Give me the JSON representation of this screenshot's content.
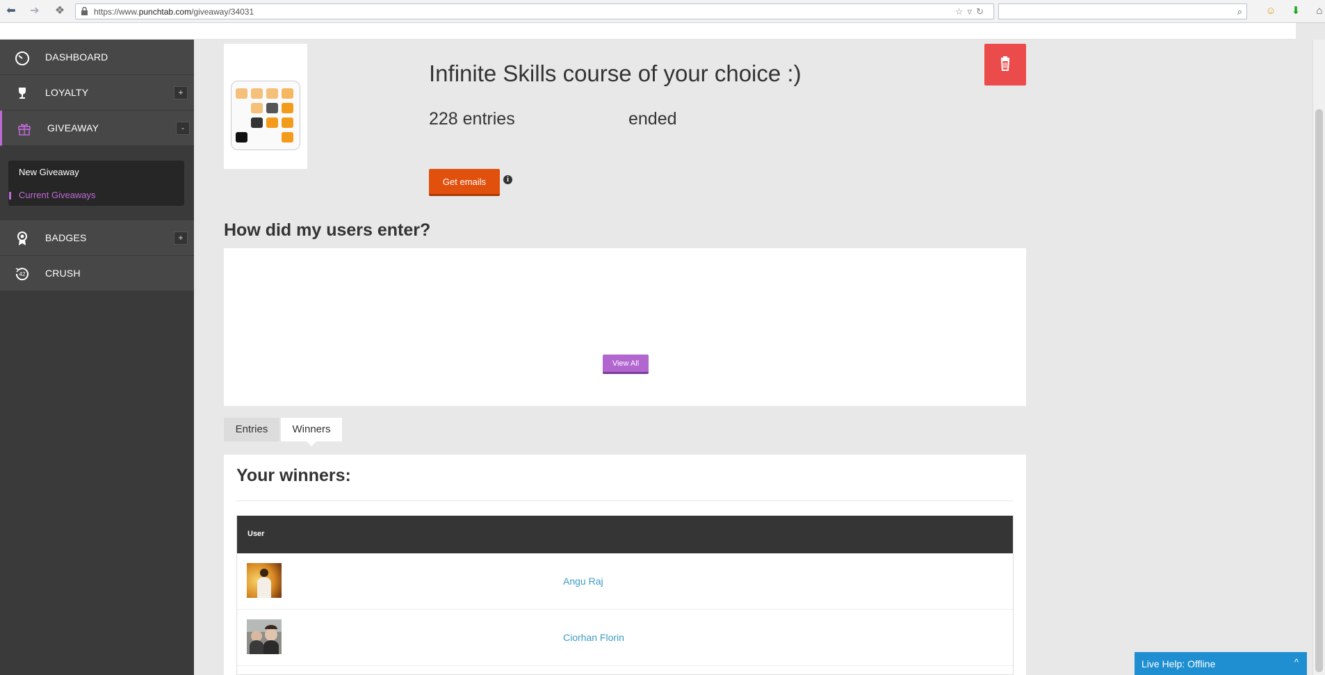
{
  "browser": {
    "url_prefix": "https://www.",
    "url_domain": "punchtab.com",
    "url_path": "/giveaway/34031"
  },
  "sidebar": {
    "items": [
      {
        "label": "DASHBOARD",
        "icon": "speedometer-icon"
      },
      {
        "label": "LOYALTY",
        "icon": "trophy-icon",
        "toggle": "+"
      },
      {
        "label": "GIVEAWAY",
        "icon": "gift-icon",
        "toggle": "-"
      },
      {
        "label": "BADGES",
        "icon": "badge-icon",
        "toggle": "+"
      },
      {
        "label": "CRUSH",
        "icon": "crush-42-icon",
        "badge": "42"
      }
    ],
    "submenu": {
      "new_giveaway": "New Giveaway",
      "current_giveaways": "Current Giveaways"
    }
  },
  "giveaway": {
    "title": "Infinite Skills course of your choice :)",
    "entries": "228 entries",
    "status": "ended",
    "get_emails": "Get emails",
    "info": "i"
  },
  "entry_section": {
    "heading": "How did my users enter?",
    "view_all": "View All"
  },
  "tabs": {
    "entries": "Entries",
    "winners": "Winners"
  },
  "winners": {
    "heading": "Your winners:",
    "column_user": "User",
    "rows": [
      {
        "name": "Angu Raj"
      },
      {
        "name": "Ciorhan Florin"
      }
    ]
  },
  "live_help": {
    "label": "Live Help: Offline",
    "caret": "^"
  },
  "colors": {
    "accent_purple": "#c06ad8",
    "delete_red": "#ec4b4b",
    "button_orange": "#e2500e",
    "link_blue": "#3c9bc6",
    "live_help_blue": "#1f8fd1"
  }
}
